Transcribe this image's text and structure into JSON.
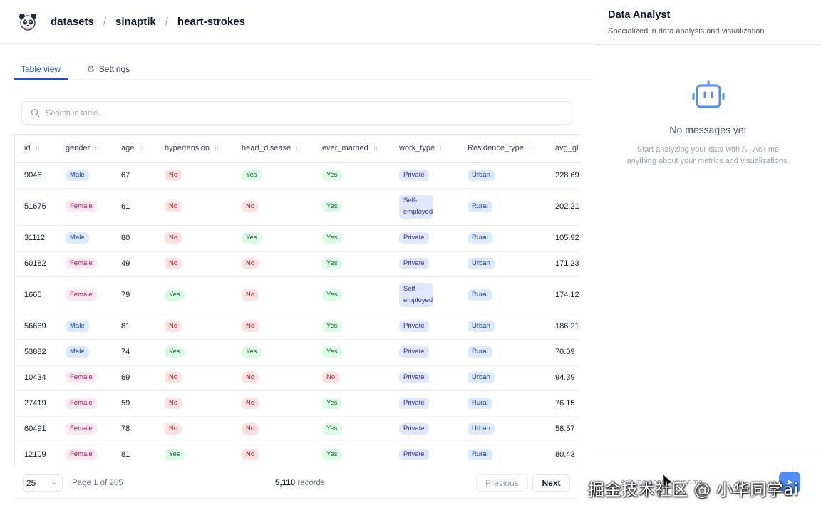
{
  "breadcrumb": [
    "datasets",
    "sinaptik",
    "heart-strokes"
  ],
  "tabs": {
    "table": "Table view",
    "settings": "Settings"
  },
  "search": {
    "placeholder": "Search in table..."
  },
  "columns": [
    "id",
    "gender",
    "age",
    "hypertension",
    "heart_disease",
    "ever_married",
    "work_type",
    "Residence_type",
    "avg_gl"
  ],
  "rows": [
    [
      "9046",
      "Male",
      "67",
      "No",
      "Yes",
      "Yes",
      "Private",
      "Urban",
      "228.69"
    ],
    [
      "51676",
      "Female",
      "61",
      "No",
      "No",
      "Yes",
      "Self-employed",
      "Rural",
      "202.21"
    ],
    [
      "31112",
      "Male",
      "80",
      "No",
      "Yes",
      "Yes",
      "Private",
      "Rural",
      "105.92"
    ],
    [
      "60182",
      "Female",
      "49",
      "No",
      "No",
      "Yes",
      "Private",
      "Urban",
      "171.23"
    ],
    [
      "1665",
      "Female",
      "79",
      "Yes",
      "No",
      "Yes",
      "Self-employed",
      "Rural",
      "174.12"
    ],
    [
      "56669",
      "Male",
      "81",
      "No",
      "No",
      "Yes",
      "Private",
      "Urban",
      "186.21"
    ],
    [
      "53882",
      "Male",
      "74",
      "Yes",
      "Yes",
      "Yes",
      "Private",
      "Rural",
      "70.09"
    ],
    [
      "10434",
      "Female",
      "69",
      "No",
      "No",
      "No",
      "Private",
      "Urban",
      "94.39"
    ],
    [
      "27419",
      "Female",
      "59",
      "No",
      "No",
      "Yes",
      "Private",
      "Rural",
      "76.15"
    ],
    [
      "60491",
      "Female",
      "78",
      "No",
      "No",
      "Yes",
      "Private",
      "Urban",
      "58.57"
    ],
    [
      "12109",
      "Female",
      "81",
      "Yes",
      "No",
      "Yes",
      "Private",
      "Rural",
      "80.43"
    ]
  ],
  "pagination": {
    "page_size": "25",
    "page_info": "Page 1 of 205",
    "records_count": "5,110",
    "records_label": "records",
    "previous": "Previous",
    "next": "Next"
  },
  "agent": {
    "title": "Data Analyst",
    "subtitle": "Specialized in data analysis and visualization",
    "empty_title": "No messages yet",
    "empty_text": "Start analyzing your data with AI. Ask me anything about your metrics and visualizations.",
    "input_placeholder": "Ask me about your data..."
  },
  "watermark": "掘金技术社区 @ 小华同学ai",
  "colors": {
    "accent": "#1d4ed8",
    "send_button": "#4f8df5",
    "bot_icon": "#4f8df5"
  }
}
